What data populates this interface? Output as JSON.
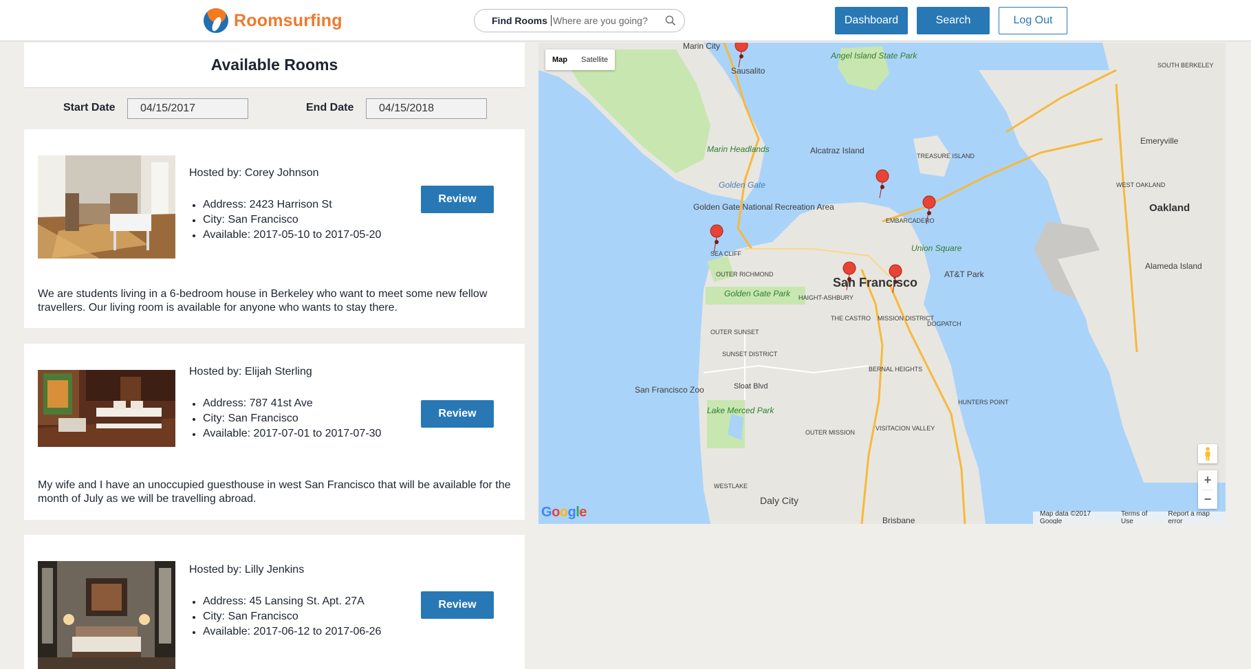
{
  "header": {
    "brand_name": "Roomsurfing",
    "search": {
      "find_label": "Find Rooms",
      "placeholder": "Where are you going?"
    },
    "buttons": {
      "dashboard": "Dashboard",
      "search": "Search",
      "logout": "Log Out"
    }
  },
  "panel": {
    "title": "Available Rooms",
    "start_date_label": "Start Date",
    "start_date": "04/15/2017",
    "end_date_label": "End Date",
    "end_date": "04/15/2018"
  },
  "rooms": [
    {
      "host": "Hosted by: Corey Johnson",
      "address": "Address: 2423 Harrison St",
      "city": "City: San Francisco",
      "available": "Available: 2017-05-10 to 2017-05-20",
      "review_label": "Review",
      "description": "We are students living in a 6-bedroom house in Berkeley who want to meet some new fellow travellers. Our living room is available for anyone who wants to stay there."
    },
    {
      "host": "Hosted by: Elijah Sterling",
      "address": "Address: 787 41st Ave",
      "city": "City: San Francisco",
      "available": "Available: 2017-07-01 to 2017-07-30",
      "review_label": "Review",
      "description": "My wife and I have an unoccupied guesthouse in west San Francisco that will be available for the month of July as we will be travelling abroad."
    },
    {
      "host": "Hosted by: Lilly Jenkins",
      "address": "Address: 45 Lansing St. Apt. 27A",
      "city": "City: San Francisco",
      "available": "Available: 2017-06-12 to 2017-06-26",
      "review_label": "Review"
    }
  ],
  "map": {
    "type_map": "Map",
    "type_satellite": "Satellite",
    "zoom_in": "+",
    "zoom_out": "−",
    "google": "Google",
    "footer": {
      "data": "Map data ©2017 Google",
      "terms": "Terms of Use",
      "report": "Report a map error"
    },
    "labels": {
      "san_francisco": "San Francisco",
      "oakland": "Oakland",
      "sausalito": "Sausalito",
      "marin_city": "Marin City",
      "angel_island": "Angel Island State Park",
      "alcatraz": "Alcatraz Island",
      "marin_headlands": "Marin Headlands",
      "golden_gate": "Golden Gate",
      "ggnra": "Golden Gate National Recreation Area",
      "golden_gate_park": "Golden Gate Park",
      "union_square": "Union Square",
      "att_park": "AT&T Park",
      "sf_zoo": "San Francisco Zoo",
      "lake_merced": "Lake Merced Park",
      "daly_city": "Daly City",
      "emeryville": "Emeryville",
      "alameda": "Alameda Island",
      "treasure_island": "TREASURE ISLAND",
      "sea_cliff": "SEA CLIFF",
      "outer_richmond": "OUTER RICHMOND",
      "haight": "HAIGHT-ASHBURY",
      "castro": "THE CASTRO",
      "mission": "MISSION DISTRICT",
      "outer_sunset": "OUTER SUNSET",
      "sunset": "SUNSET DISTRICT",
      "bernal": "BERNAL HEIGHTS",
      "dogpatch": "DOGPATCH",
      "hunters_point": "HUNTERS POINT",
      "visitacion": "VISITACION VALLEY",
      "outer_mission": "OUTER MISSION",
      "westlake": "WESTLAKE",
      "embarcadero": "EMBARCADERO",
      "brisbane": "Brisbane",
      "sloat": "Sloat Blvd",
      "west_oakland": "WEST OAKLAND",
      "south_berkeley": "SOUTH BERKELEY"
    }
  },
  "colors": {
    "accent": "#2878b5",
    "brand_orange": "#ee7a2c",
    "water": "#aad3f9",
    "land": "#e8e6e1",
    "park": "#c8e6b0",
    "marker": "#e94335"
  }
}
